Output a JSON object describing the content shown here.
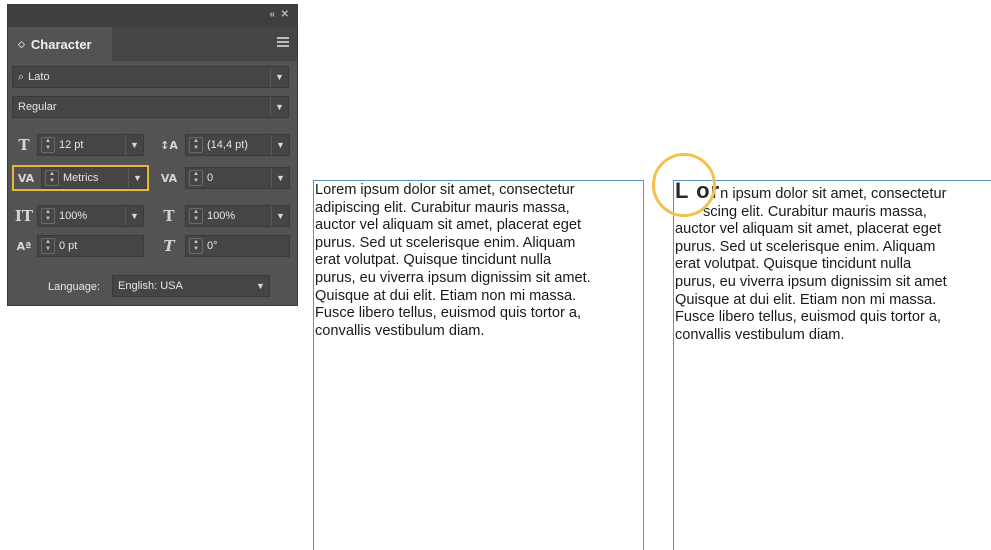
{
  "panel": {
    "collapse_icon": "«",
    "close_icon": "✕",
    "tab_label": "Character",
    "font_family": "Lato",
    "font_style": "Regular",
    "font_size": "12 pt",
    "leading": "(14,4 pt)",
    "kerning": "Metrics",
    "tracking": "0",
    "vertical_scale": "100%",
    "horizontal_scale": "100%",
    "baseline_shift": "0 pt",
    "skew": "0°",
    "language_label": "Language:",
    "language_value": "English: USA"
  },
  "frames": {
    "left_lines": [
      "Lorem ipsum dolor sit amet, consectetur",
      "adipiscing elit. Curabitur mauris massa,",
      "auctor vel aliquam sit amet, placerat eget",
      "purus. Sed ut scelerisque enim. Aliquam",
      "erat volutpat. Quisque tincidunt nulla",
      "purus, eu viverra ipsum dignissim sit amet.",
      "Quisque at dui elit. Etiam non mi massa.",
      "Fusce libero tellus, euismod quis tortor a,",
      "convallis vestibulum diam."
    ],
    "right_first_big": "L or",
    "right_first_rest": "n ipsum dolor sit amet, consectetur",
    "right_second": "scing elit. Curabitur mauris massa,",
    "right_lines": [
      "auctor vel aliquam sit amet, placerat eget",
      "purus. Sed ut scelerisque enim. Aliquam",
      "erat volutpat. Quisque tincidunt nulla",
      "purus, eu viverra ipsum dignissim sit amet",
      "Quisque at dui elit. Etiam non mi massa.",
      "Fusce libero tellus, euismod quis tortor a,",
      "convallis vestibulum diam."
    ]
  },
  "icons": {
    "search": "search-icon",
    "dropdown": "chevron-down-icon",
    "highlight_color": "#e8b83a",
    "circle_color": "#f2c14e",
    "frame_border_color": "#5a8ecb"
  }
}
